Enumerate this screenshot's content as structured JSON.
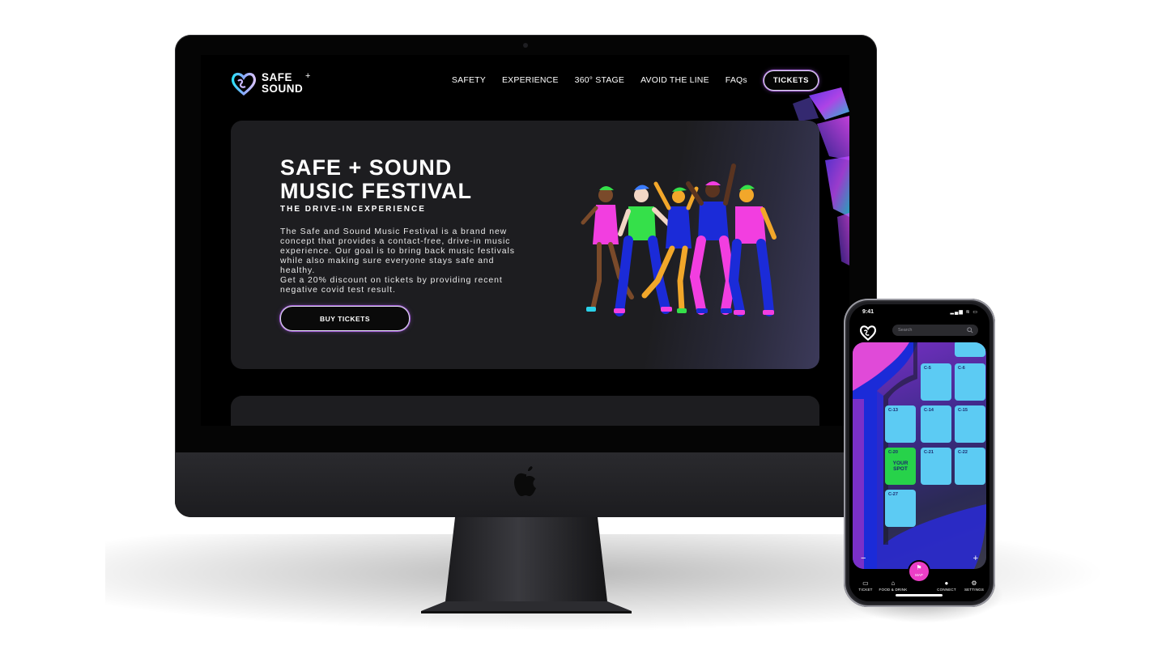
{
  "site": {
    "logo_line1": "SAFE",
    "logo_line2": "SOUND",
    "logo_plus": "+",
    "nav": [
      "SAFETY",
      "EXPERIENCE",
      "360° STAGE",
      "AVOID THE LINE",
      "FAQs"
    ],
    "tickets_label": "TICKETS",
    "hero": {
      "title_line1": "SAFE + SOUND",
      "title_line2": "MUSIC FESTIVAL",
      "subtitle": "THE DRIVE-IN EXPERIENCE",
      "description": "The Safe and Sound Music Festival is a brand new concept that provides a contact-free, drive-in music experience. Our goal is to bring back music festivals while also making sure everyone stays safe and healthy.",
      "discount": "Get a 20% discount on tickets by providing recent negative covid test result.",
      "cta": "BUY TICKETS"
    }
  },
  "phone": {
    "time": "9:41",
    "status": "▂▄▆ ≋ ▭",
    "search_placeholder": "Search",
    "spots": [
      {
        "label": "C-5"
      },
      {
        "label": "C-6"
      },
      {
        "label": "C-13"
      },
      {
        "label": "C-14"
      },
      {
        "label": "C-15"
      },
      {
        "label": "C-20",
        "note": "YOUR SPOT"
      },
      {
        "label": "C-21"
      },
      {
        "label": "C-22"
      },
      {
        "label": "C-27"
      }
    ],
    "zoom_out": "−",
    "zoom_in": "+",
    "tabs": {
      "ticket": "TICKET",
      "food": "FOOD & DRINK",
      "map": "MAP",
      "connect": "CONNECT",
      "settings": "SETTINGS"
    }
  },
  "colors": {
    "accent_pink": "#ec3ec7",
    "spot_blue": "#5ccbf3",
    "your_spot_green": "#27d24a",
    "hero_bg": "#1d1d20"
  }
}
